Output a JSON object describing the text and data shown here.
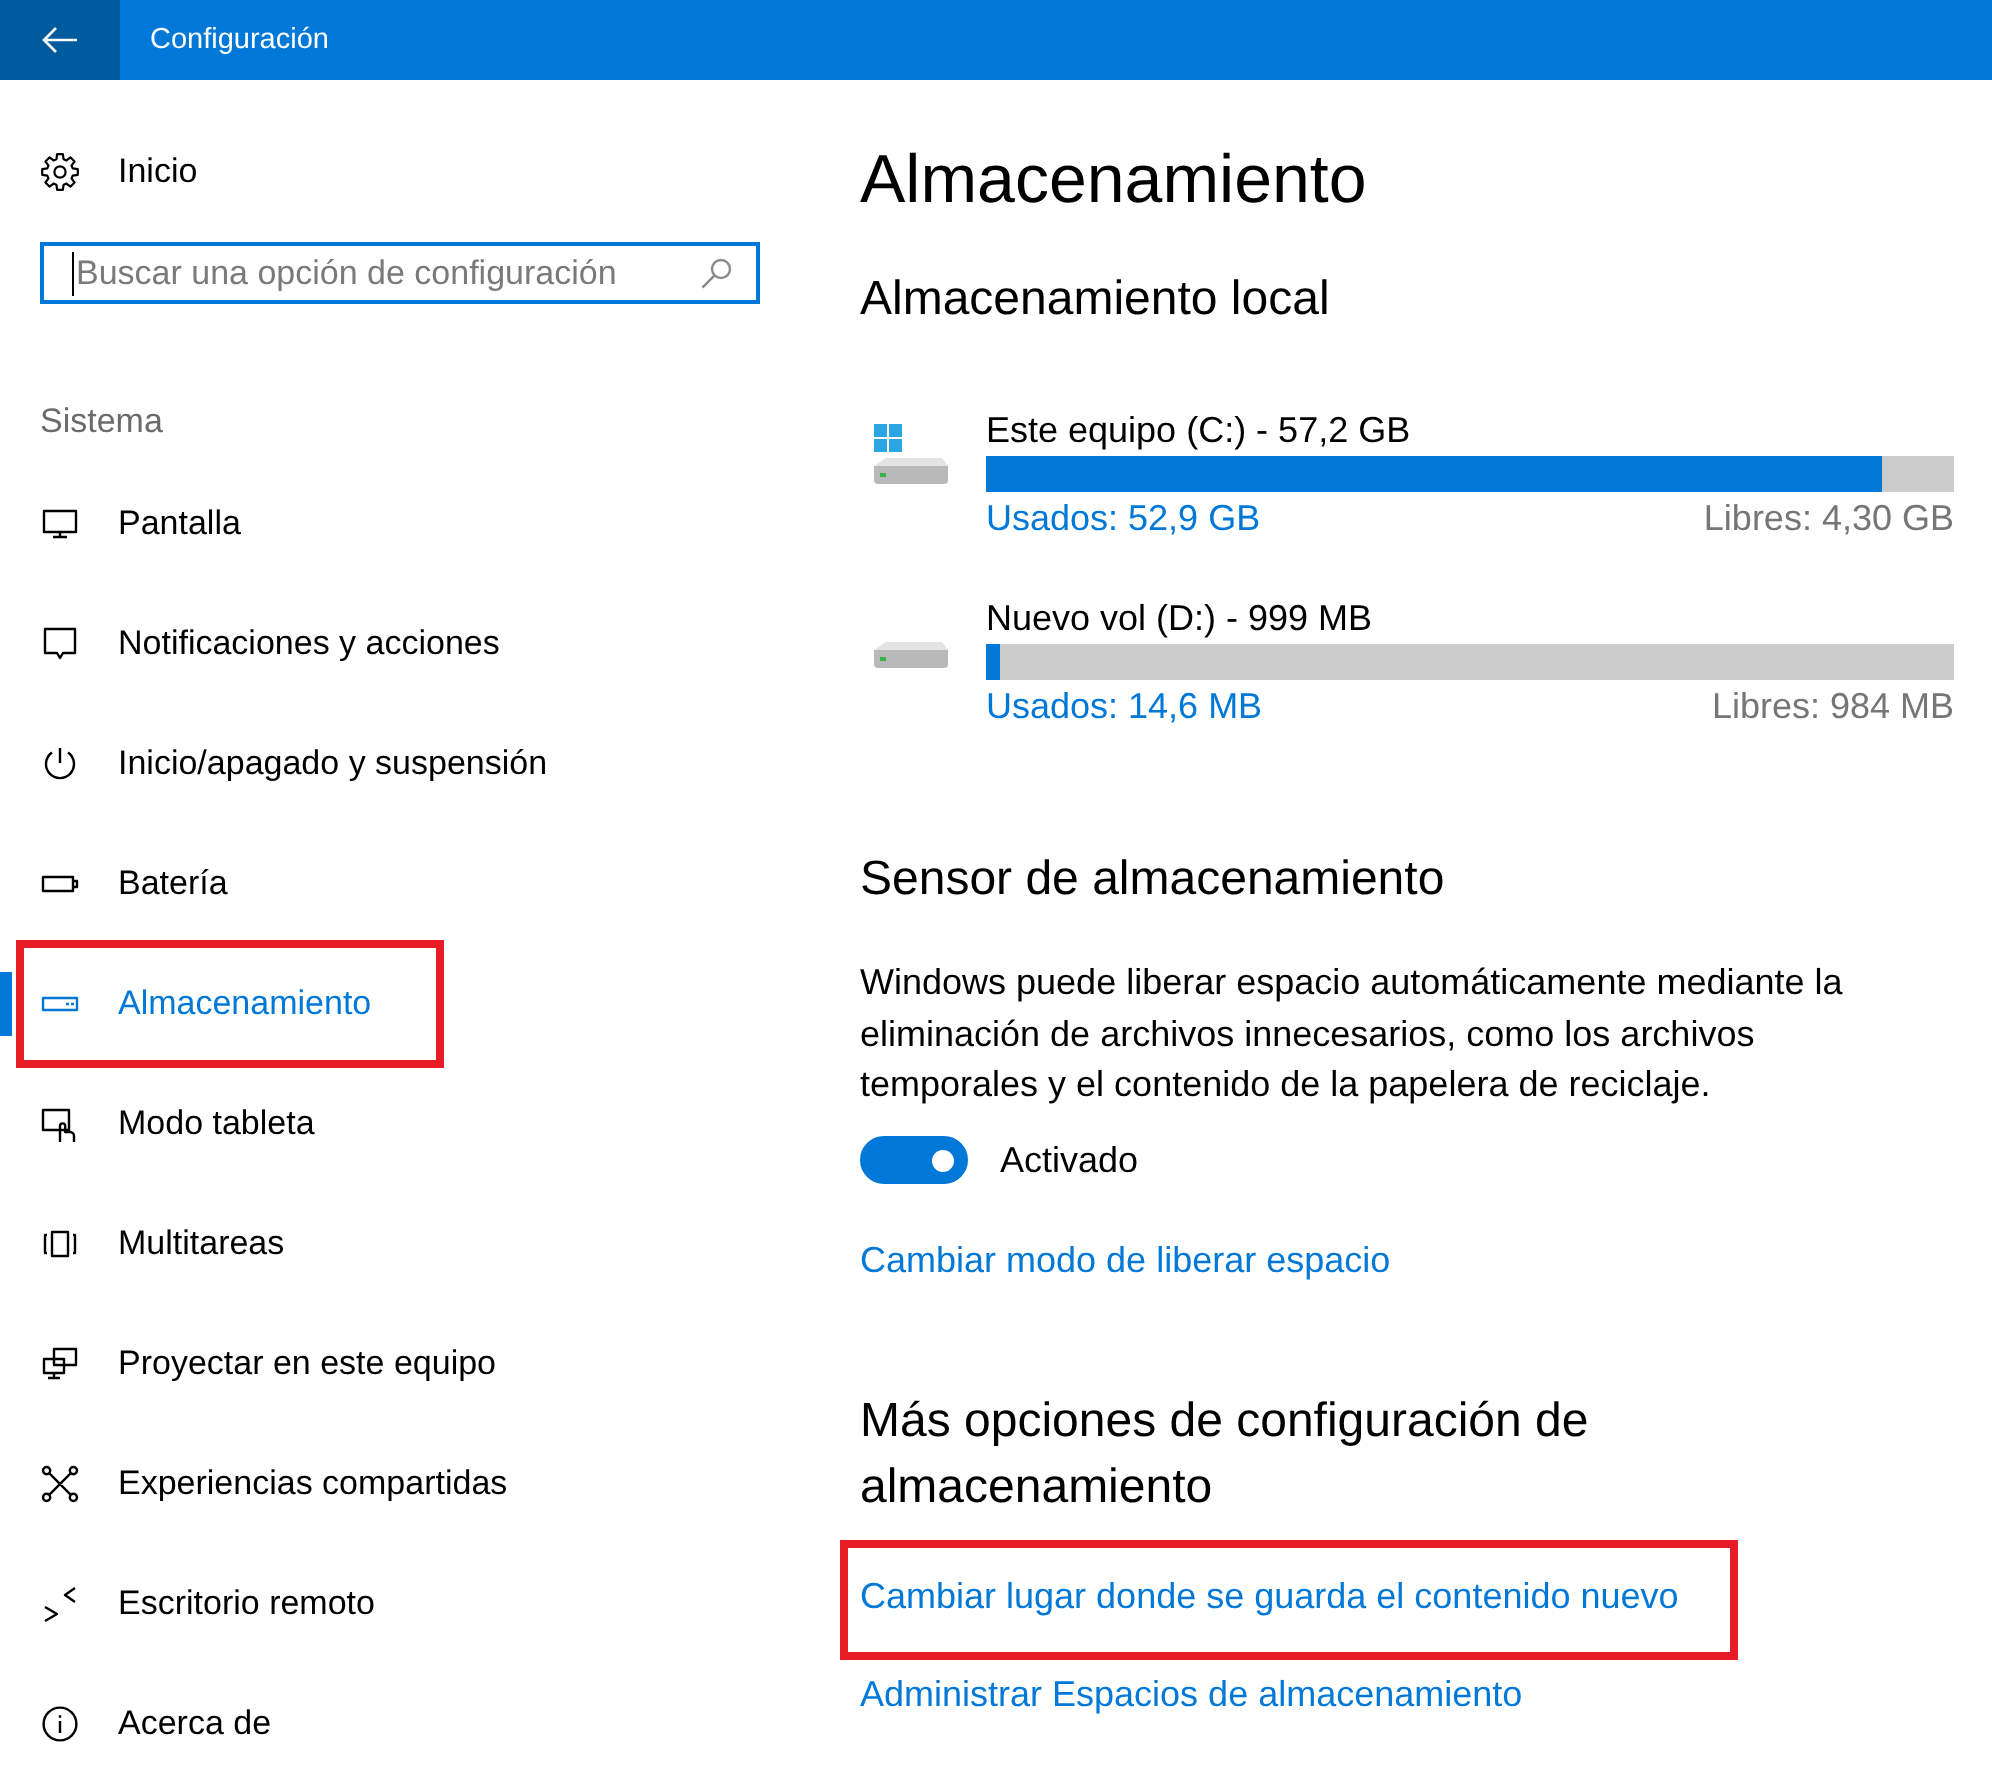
{
  "title_bar": {
    "title": "Configuración"
  },
  "sidebar": {
    "home": "Inicio",
    "search": {
      "placeholder": "Buscar una opción de configuración",
      "focused": true
    },
    "section": "Sistema",
    "items": [
      {
        "label": "Pantalla",
        "selected": false,
        "highlighted": false
      },
      {
        "label": "Notificaciones y acciones",
        "selected": false,
        "highlighted": false
      },
      {
        "label": "Inicio/apagado y suspensión",
        "selected": false,
        "highlighted": false
      },
      {
        "label": "Batería",
        "selected": false,
        "highlighted": false
      },
      {
        "label": "Almacenamiento",
        "selected": true,
        "highlighted": true
      },
      {
        "label": "Modo tableta",
        "selected": false,
        "highlighted": false
      },
      {
        "label": "Multitareas",
        "selected": false,
        "highlighted": false
      },
      {
        "label": "Proyectar en este equipo",
        "selected": false,
        "highlighted": false
      },
      {
        "label": "Experiencias compartidas",
        "selected": false,
        "highlighted": false
      },
      {
        "label": "Escritorio remoto",
        "selected": false,
        "highlighted": false
      },
      {
        "label": "Acerca de",
        "selected": false,
        "highlighted": false
      }
    ]
  },
  "page": {
    "title": "Almacenamiento",
    "local_storage": {
      "heading": "Almacenamiento local",
      "drives": [
        {
          "kind": "system",
          "name": "Este equipo (C:) - 57,2 GB",
          "level": 0.925,
          "used": "Usados: 52,9 GB",
          "free": "Libres: 4,30 GB"
        },
        {
          "kind": "data",
          "name": "Nuevo vol (D:) - 999 MB",
          "level": 0.015,
          "used": "Usados: 14,6 MB",
          "free": "Libres: 984 MB"
        }
      ]
    },
    "storage_sense": {
      "heading": "Sensor de almacenamiento",
      "description": "Windows puede liberar espacio automáticamente mediante la eliminación de archivos innecesarios, como los archivos temporales y el contenido de la papelera de reciclaje.",
      "toggle": {
        "on": true,
        "label": "Activado"
      },
      "link": "Cambiar modo de liberar espacio"
    },
    "more_options": {
      "heading": "Más opciones de configuración de almacenamiento",
      "links": [
        {
          "label": "Cambiar lugar donde se guarda el contenido nuevo",
          "highlighted": true
        },
        {
          "label": "Administrar Espacios de almacenamiento",
          "highlighted": false
        }
      ]
    }
  }
}
